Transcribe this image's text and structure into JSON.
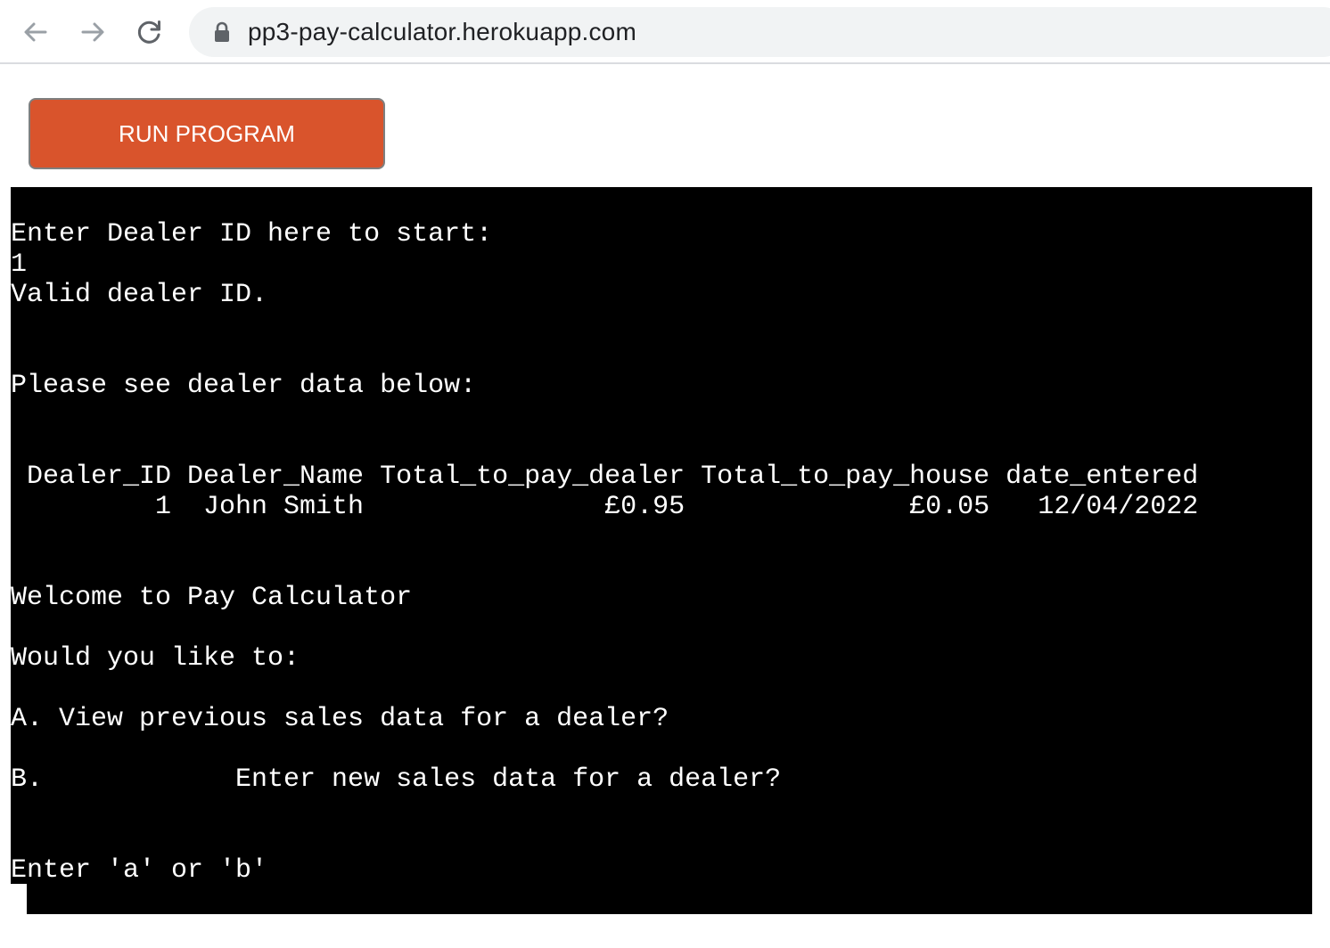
{
  "browser": {
    "url": "pp3-pay-calculator.herokuapp.com",
    "icons": {
      "back": "arrow-left-icon",
      "forward": "arrow-right-icon",
      "reload": "reload-icon",
      "lock": "lock-icon"
    }
  },
  "app": {
    "run_button_label": "RUN PROGRAM",
    "accent_color": "#d9542c"
  },
  "terminal": {
    "background": "#000000",
    "foreground": "#ffffff",
    "lines": [
      "Enter Dealer ID here to start:",
      "1",
      "Valid dealer ID.",
      "Please see dealer data below:",
      " Dealer_ID Dealer_Name Total_to_pay_dealer Total_to_pay_house date_entered",
      "         1  John Smith               £0.95              £0.05   12/04/2022",
      "Welcome to Pay Calculator",
      "Would you like to:",
      "A. View previous sales data for a dealer?",
      "B.            Enter new sales data for a dealer?",
      "Enter 'a' or 'b'"
    ]
  }
}
